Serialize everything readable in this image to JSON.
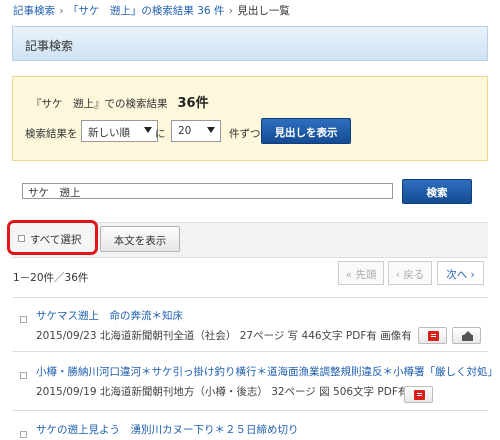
{
  "breadcrumb": {
    "home": "記事検索",
    "sep1": "›",
    "results": "「サケ　遡上」の検索結果 36 件",
    "sep2": "›",
    "current": "見出し一覧"
  },
  "header": {
    "title": "記事検索"
  },
  "summary": {
    "query_label": "『サケ　遡上』での検索結果",
    "count": "36件",
    "order_label": "検索結果を",
    "order_value": "新しい順",
    "ni_label": "に",
    "per_page_value": "20",
    "per_page_suffix": "件ずつ",
    "show_headlines_button": "見出しを表示"
  },
  "search": {
    "input_value": "サケ　遡上",
    "button": "検索"
  },
  "toolbar": {
    "select_all": "すべて選択",
    "show_text": "本文を表示"
  },
  "pagination": {
    "range": "1－20件／36件",
    "first": "« 先頭",
    "prev": "‹ 戻る",
    "next": "次へ ›"
  },
  "articles": [
    {
      "title": "サケマス遡上　命の奔流＊知床",
      "meta": "2015/09/23 北海道新聞朝刊全道（社会）  27ページ 写 446文字 PDF有 画像有",
      "pdf_icon": "pdf-icon",
      "image_icon": "image-icon"
    },
    {
      "title": "小樽・勝納川河口違河＊サケ引っ掛け釣り横行＊道海面漁業調整規則違反＊小樽署「厳しく対処」",
      "meta": "2015/09/19 北海道新聞朝刊地方（小樽・後志）  32ページ 図 506文字 PDF有",
      "pdf_icon": "pdf-icon"
    },
    {
      "title": "サケの遡上見よう　湧別川カヌー下り＊２５日締め切り"
    }
  ],
  "colors": {
    "link": "#1f5fb0",
    "accent_button": "#1f5aa6",
    "highlight": "#e0161b",
    "summary_bg": "#fdf8dc"
  }
}
